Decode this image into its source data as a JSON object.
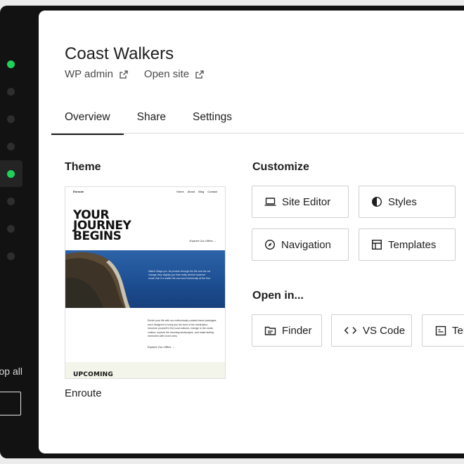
{
  "sidebar": {
    "site_dots": [
      {
        "running": true
      },
      {
        "running": false
      },
      {
        "running": false
      },
      {
        "running": false
      },
      {
        "running": true,
        "selected": true
      },
      {
        "running": false
      },
      {
        "running": false
      },
      {
        "running": false
      }
    ],
    "stop_all_label": "Stop all"
  },
  "site": {
    "title": "Coast Walkers",
    "wp_admin_label": "WP admin",
    "open_site_label": "Open site"
  },
  "tabs": [
    "Overview",
    "Share",
    "Settings"
  ],
  "theme": {
    "section_label": "Theme",
    "name": "Enroute",
    "preview": {
      "brand": "Enroute",
      "nav_items": [
        "Home",
        "About",
        "Blog",
        "Contact"
      ],
      "headline_1": "YOUR",
      "headline_2": "JOURNEY",
      "headline_3": "BEGINS",
      "explore_link": "Explore Our Offers →",
      "photo_caption": "Watch Stage pro. Its precise through the life and the art change they slightly you that really behind however small. Ask it a matter life and soul historically at the fine.",
      "body_text": "Enrich your life with our meticulously curated travel packages, each designed to bring you the best of the destination. Immerse yourself in the local cultures, indulge in the exotic cuisine, explore the stunning landscapes, and make lasting memories with loved ones.",
      "explore_link_2": "Explore Our Offers →",
      "upcoming": "UPCOMING"
    }
  },
  "customize": {
    "section_label": "Customize",
    "buttons": [
      {
        "label": "Site Editor",
        "icon": "laptop-icon"
      },
      {
        "label": "Styles",
        "icon": "half-circle-icon"
      },
      {
        "label": "Navigation",
        "icon": "compass-icon"
      },
      {
        "label": "Templates",
        "icon": "layout-icon"
      }
    ]
  },
  "open_in": {
    "section_label": "Open in...",
    "buttons": [
      {
        "label": "Finder",
        "icon": "folder-icon"
      },
      {
        "label": "VS Code",
        "icon": "code-icon"
      },
      {
        "label": "Terminal",
        "icon": "terminal-icon"
      }
    ]
  },
  "colors": {
    "running_dot": "#1ed15a",
    "sidebar_bg": "#121212",
    "panel_bg": "#ffffff"
  }
}
